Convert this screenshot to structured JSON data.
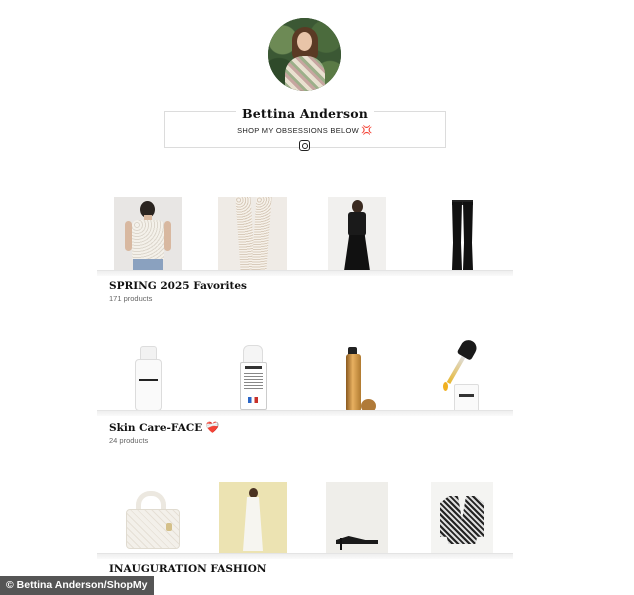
{
  "profile": {
    "name": "Bettina Anderson",
    "tagline": "SHOP MY OBSESSIONS BELOW",
    "tagline_emoji": "💢",
    "social_icon": "instagram-icon"
  },
  "collections": [
    {
      "title": "SPRING 2025 Favorites",
      "count": "171 products",
      "emoji": ""
    },
    {
      "title": "Skin Care-FACE",
      "count": "24 products",
      "emoji": "❤️‍🩹"
    },
    {
      "title": "INAUGURATION FASHION",
      "count": "",
      "emoji": ""
    }
  ],
  "credit": "© Bettina Anderson/ShopMy",
  "colors": {
    "text": "#111111",
    "muted": "#666666",
    "border": "#dcdcdc",
    "heart": "#c0142a"
  }
}
